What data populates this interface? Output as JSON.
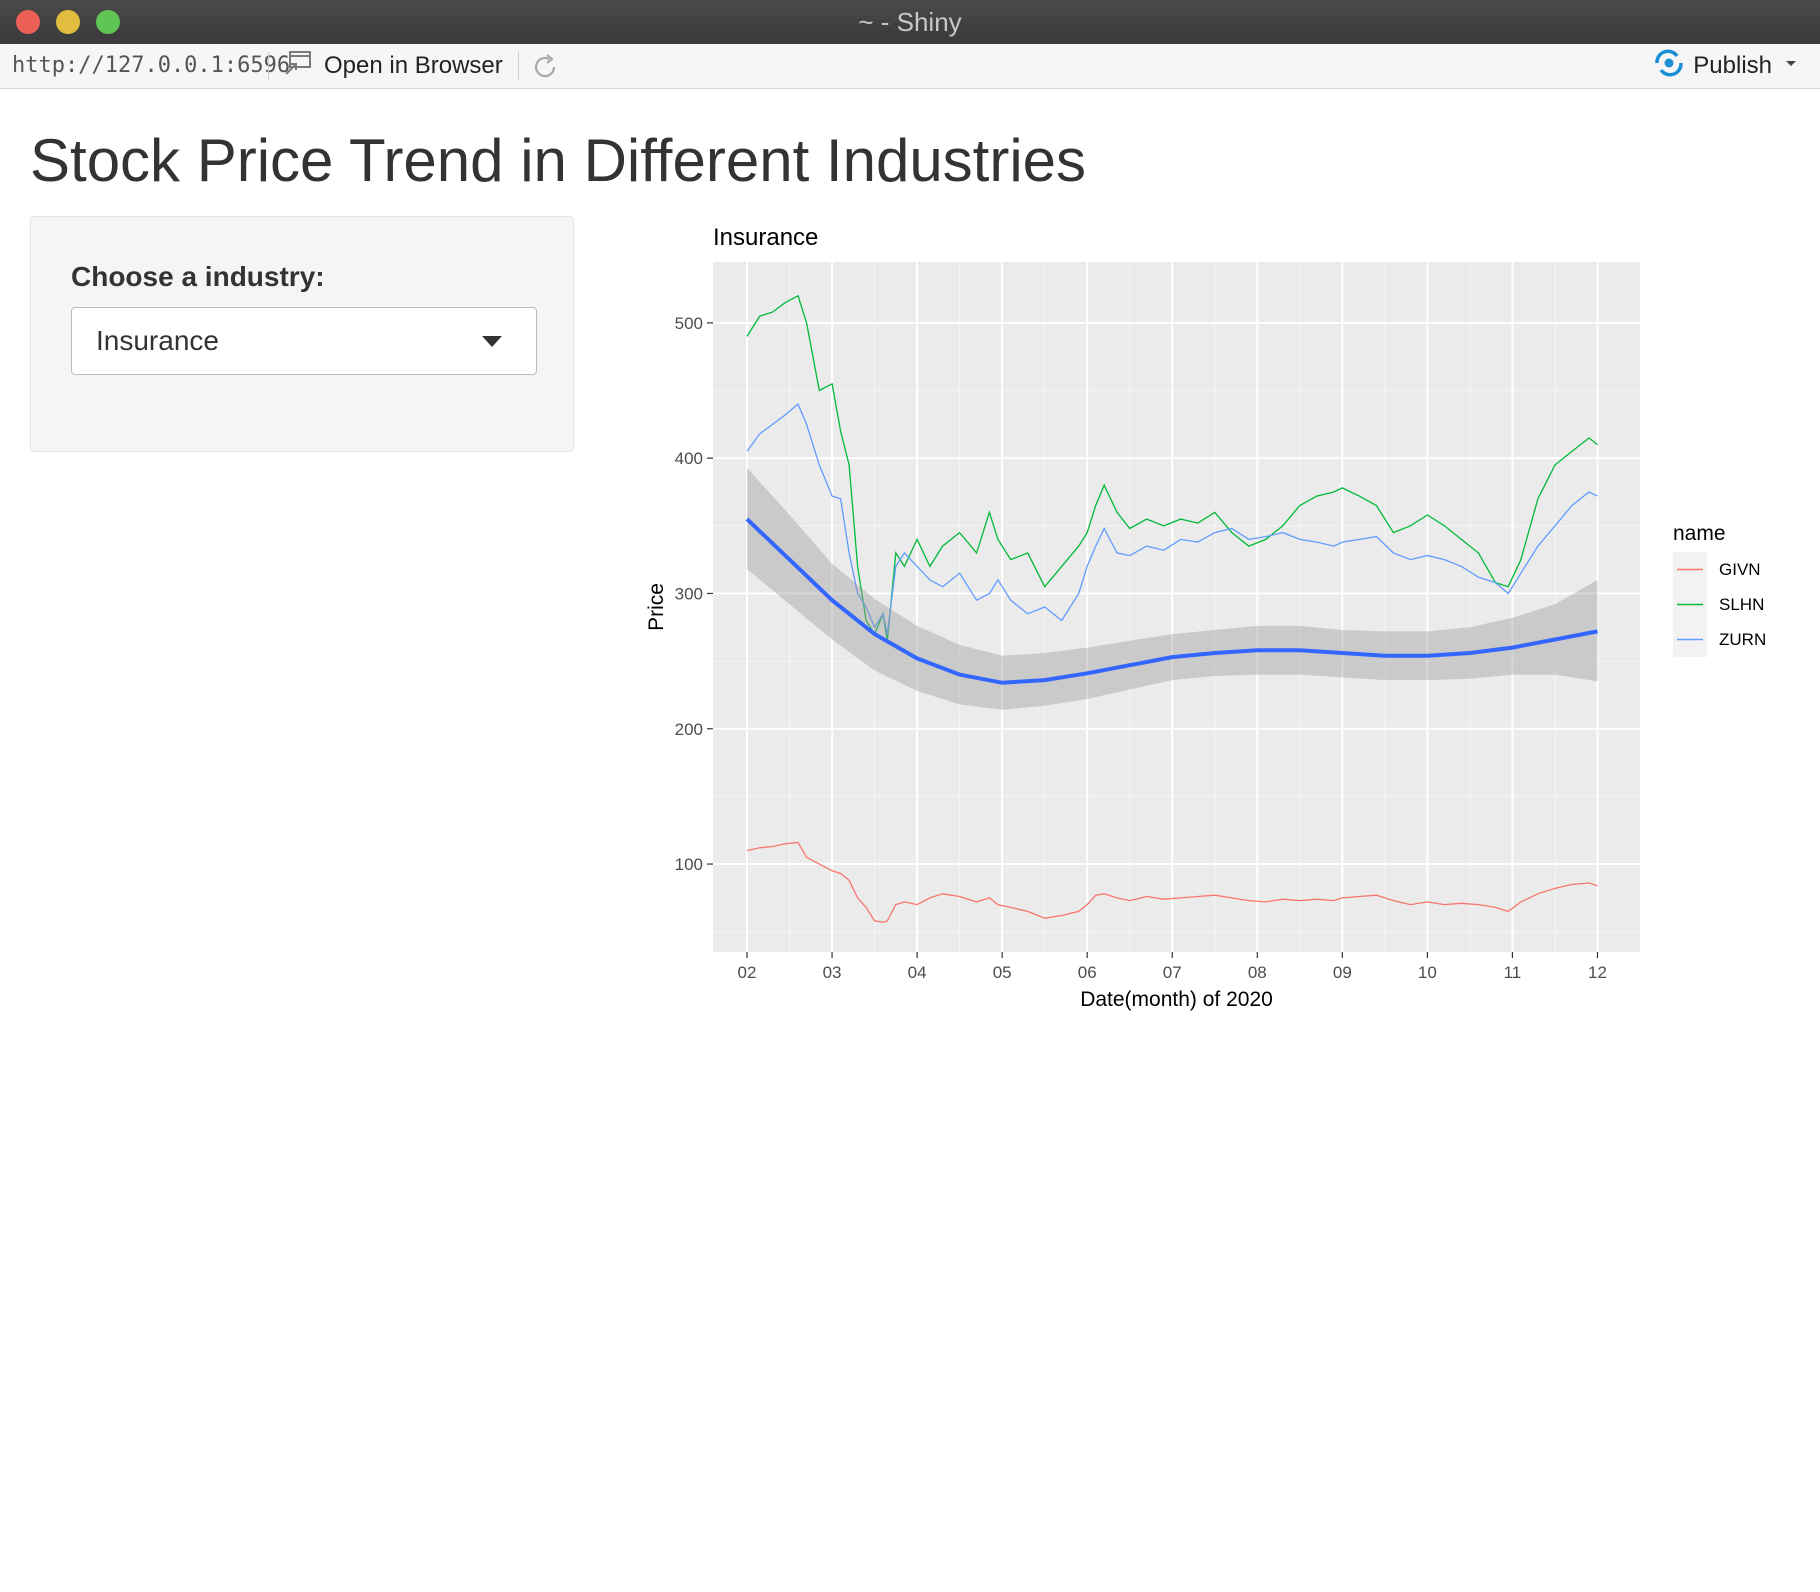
{
  "window": {
    "title": "~ - Shiny"
  },
  "toolbar": {
    "url": "http://127.0.0.1:6596",
    "open_label": "Open in Browser",
    "publish_label": "Publish"
  },
  "page": {
    "title": "Stock Price Trend in Different Industries"
  },
  "sidebar": {
    "label": "Choose a industry:",
    "selected": "Insurance"
  },
  "colors": {
    "GIVN": "#f8766d",
    "SLHN": "#00ba38",
    "ZURN": "#619cff",
    "smooth": "#3366ff",
    "panel": "#ebebeb",
    "accent_publish": "#1a8fd6"
  },
  "chart_data": {
    "type": "line",
    "title": "Insurance",
    "xlabel": "Date(month) of 2020",
    "ylabel": "Price",
    "x_ticks": [
      "02",
      "03",
      "04",
      "05",
      "06",
      "07",
      "08",
      "09",
      "10",
      "11",
      "12"
    ],
    "y_ticks": [
      100,
      200,
      300,
      400,
      500
    ],
    "xlim": [
      1.6,
      12.5
    ],
    "ylim": [
      35,
      545
    ],
    "grid": true,
    "legend": {
      "title": "name",
      "position": "right",
      "entries": [
        "GIVN",
        "SLHN",
        "ZURN"
      ]
    },
    "series": [
      {
        "name": "SLHN",
        "x": [
          2.0,
          2.15,
          2.3,
          2.45,
          2.6,
          2.7,
          2.85,
          3.0,
          3.1,
          3.2,
          3.3,
          3.4,
          3.5,
          3.6,
          3.65,
          3.75,
          3.85,
          4.0,
          4.15,
          4.3,
          4.5,
          4.7,
          4.85,
          4.95,
          5.1,
          5.3,
          5.5,
          5.7,
          5.9,
          6.0,
          6.1,
          6.2,
          6.35,
          6.5,
          6.7,
          6.9,
          7.1,
          7.3,
          7.5,
          7.7,
          7.9,
          8.1,
          8.3,
          8.5,
          8.7,
          8.9,
          9.0,
          9.2,
          9.4,
          9.6,
          9.8,
          10.0,
          10.2,
          10.4,
          10.6,
          10.8,
          10.95,
          11.1,
          11.3,
          11.5,
          11.7,
          11.9,
          12.0
        ],
        "y": [
          490,
          505,
          508,
          515,
          520,
          500,
          450,
          455,
          420,
          395,
          320,
          280,
          270,
          285,
          265,
          330,
          320,
          340,
          320,
          335,
          345,
          330,
          360,
          340,
          325,
          330,
          305,
          320,
          335,
          345,
          365,
          380,
          360,
          348,
          355,
          350,
          355,
          352,
          360,
          345,
          335,
          340,
          350,
          365,
          372,
          375,
          378,
          372,
          365,
          345,
          350,
          358,
          350,
          340,
          330,
          308,
          305,
          325,
          370,
          395,
          405,
          415,
          410
        ]
      },
      {
        "name": "ZURN",
        "x": [
          2.0,
          2.15,
          2.3,
          2.45,
          2.6,
          2.7,
          2.85,
          3.0,
          3.1,
          3.2,
          3.3,
          3.4,
          3.5,
          3.6,
          3.65,
          3.75,
          3.85,
          4.0,
          4.15,
          4.3,
          4.5,
          4.7,
          4.85,
          4.95,
          5.1,
          5.3,
          5.5,
          5.7,
          5.9,
          6.0,
          6.1,
          6.2,
          6.35,
          6.5,
          6.7,
          6.9,
          7.1,
          7.3,
          7.5,
          7.7,
          7.9,
          8.1,
          8.3,
          8.5,
          8.7,
          8.9,
          9.0,
          9.2,
          9.4,
          9.6,
          9.8,
          10.0,
          10.2,
          10.4,
          10.6,
          10.8,
          10.95,
          11.1,
          11.3,
          11.5,
          11.7,
          11.9,
          12.0
        ],
        "y": [
          405,
          418,
          425,
          432,
          440,
          425,
          395,
          372,
          370,
          330,
          300,
          290,
          275,
          285,
          270,
          320,
          330,
          320,
          310,
          305,
          315,
          295,
          300,
          310,
          295,
          285,
          290,
          280,
          300,
          320,
          335,
          348,
          330,
          328,
          335,
          332,
          340,
          338,
          345,
          348,
          340,
          342,
          345,
          340,
          338,
          335,
          338,
          340,
          342,
          330,
          325,
          328,
          325,
          320,
          312,
          308,
          300,
          315,
          335,
          350,
          365,
          375,
          372
        ]
      },
      {
        "name": "GIVN",
        "x": [
          2.0,
          2.15,
          2.3,
          2.45,
          2.6,
          2.7,
          2.85,
          3.0,
          3.1,
          3.2,
          3.3,
          3.4,
          3.5,
          3.6,
          3.65,
          3.75,
          3.85,
          4.0,
          4.15,
          4.3,
          4.5,
          4.7,
          4.85,
          4.95,
          5.1,
          5.3,
          5.5,
          5.7,
          5.9,
          6.0,
          6.1,
          6.2,
          6.35,
          6.5,
          6.7,
          6.9,
          7.1,
          7.3,
          7.5,
          7.7,
          7.9,
          8.1,
          8.3,
          8.5,
          8.7,
          8.9,
          9.0,
          9.2,
          9.4,
          9.6,
          9.8,
          10.0,
          10.2,
          10.4,
          10.6,
          10.8,
          10.95,
          11.1,
          11.3,
          11.5,
          11.7,
          11.9,
          12.0
        ],
        "y": [
          110,
          112,
          113,
          115,
          116,
          105,
          100,
          95,
          93,
          88,
          75,
          68,
          58,
          57,
          58,
          70,
          72,
          70,
          75,
          78,
          76,
          72,
          75,
          70,
          68,
          65,
          60,
          62,
          65,
          70,
          77,
          78,
          75,
          73,
          76,
          74,
          75,
          76,
          77,
          75,
          73,
          72,
          74,
          73,
          74,
          73,
          75,
          76,
          77,
          73,
          70,
          72,
          70,
          71,
          70,
          68,
          65,
          72,
          78,
          82,
          85,
          86,
          84
        ]
      }
    ],
    "smooth": {
      "x": [
        2.0,
        2.5,
        3.0,
        3.5,
        4.0,
        4.5,
        5.0,
        5.5,
        6.0,
        6.5,
        7.0,
        7.5,
        8.0,
        8.5,
        9.0,
        9.5,
        10.0,
        10.5,
        11.0,
        11.5,
        12.0
      ],
      "y": [
        355,
        325,
        295,
        270,
        252,
        240,
        234,
        236,
        241,
        247,
        253,
        256,
        258,
        258,
        256,
        254,
        254,
        256,
        260,
        266,
        272
      ],
      "lower": [
        318,
        292,
        266,
        243,
        228,
        218,
        214,
        217,
        222,
        229,
        236,
        239,
        240,
        240,
        238,
        236,
        236,
        237,
        240,
        240,
        235
      ],
      "upper": [
        393,
        358,
        322,
        296,
        276,
        262,
        254,
        256,
        260,
        265,
        270,
        273,
        276,
        276,
        273,
        272,
        272,
        275,
        282,
        292,
        310
      ]
    }
  }
}
